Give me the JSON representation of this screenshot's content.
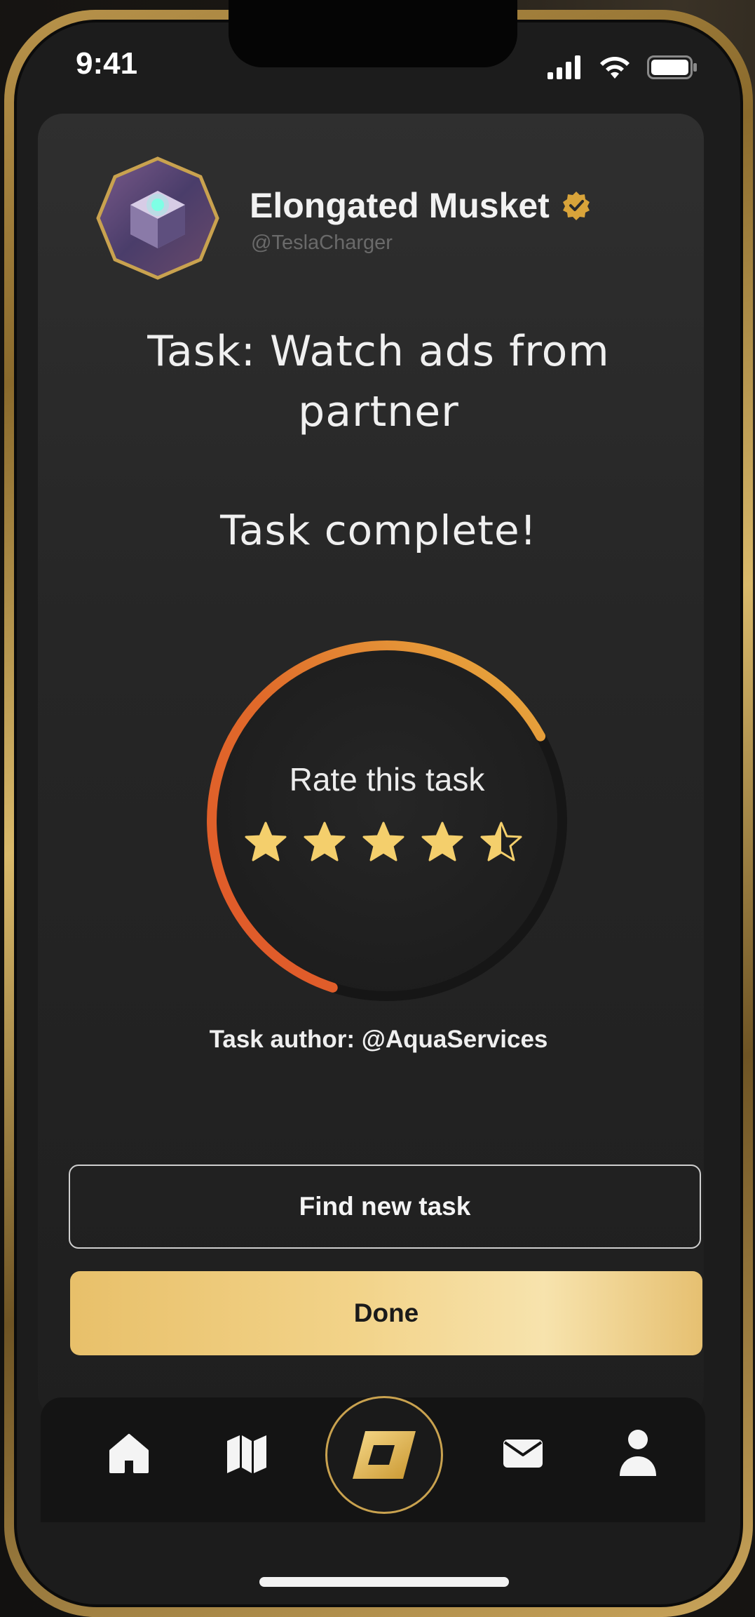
{
  "status_bar": {
    "time": "9:41",
    "icons": [
      "signal-icon",
      "wifi-icon",
      "battery-icon"
    ]
  },
  "profile": {
    "name": "Elongated Musket",
    "handle": "@TeslaCharger",
    "verified": true,
    "avatar_icon": "maze-cube-avatar"
  },
  "task": {
    "title": "Task: Watch ads from partner",
    "status": "Task complete!",
    "author": "Task author: @AquaServices"
  },
  "rating": {
    "label": "Rate this task",
    "stars_total": 5,
    "stars_value": 4.5,
    "progress_fraction": 0.62
  },
  "actions": {
    "find_new_task": "Find new task",
    "done": "Done"
  },
  "bottom_nav": {
    "items": [
      {
        "icon": "home-icon"
      },
      {
        "icon": "map-icon"
      },
      {
        "icon": "app-logo-icon"
      },
      {
        "icon": "mail-icon"
      },
      {
        "icon": "profile-icon"
      }
    ]
  },
  "colors": {
    "accent_gold": "#e8c06a",
    "ring_start": "#e0562a",
    "ring_end": "#e8b040",
    "star": "#f4cf6c",
    "card": "#2a2a2a"
  }
}
